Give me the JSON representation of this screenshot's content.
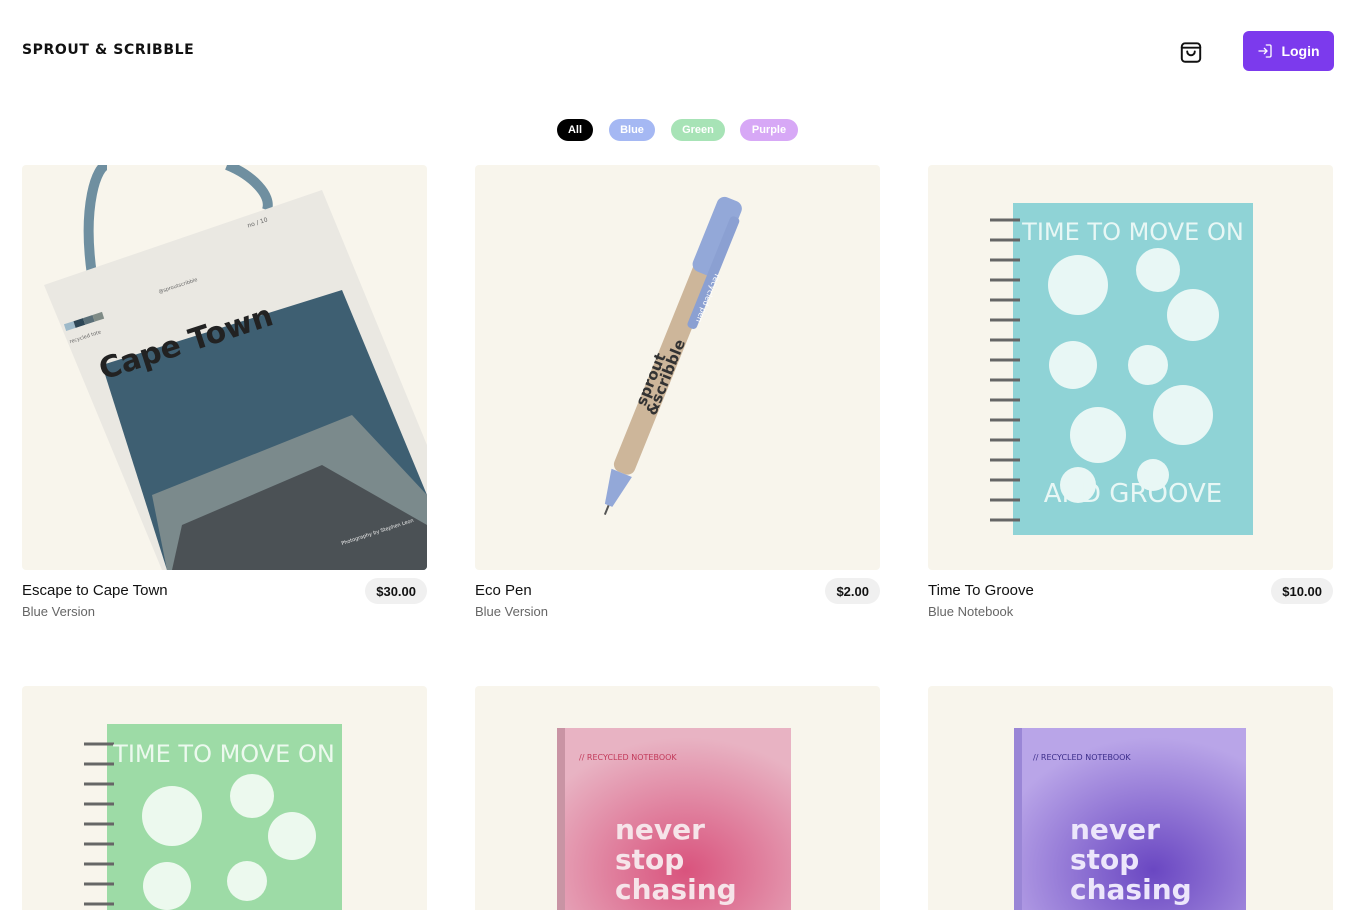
{
  "brand": "SPROUT & SCRIBBLE",
  "header": {
    "cart_icon": "shopping-bag-icon",
    "login_label": "Login",
    "login_icon": "login-arrow-icon",
    "accent": "#7c3aed"
  },
  "filters": [
    {
      "label": "All",
      "color": "#000000"
    },
    {
      "label": "Blue",
      "color": "#a5b8f3"
    },
    {
      "label": "Green",
      "color": "#a7e3b6"
    },
    {
      "label": "Purple",
      "color": "#d7a8f6"
    }
  ],
  "products": [
    {
      "name": "Escape to Cape Town",
      "variant": "Blue Version",
      "price": "$30.00",
      "art": {
        "title": "Cape Town",
        "tag": "recycled tote",
        "handle": "@sproutscribble",
        "count": "no / 10",
        "credit": "Photography by Stephen Leon"
      }
    },
    {
      "name": "Eco Pen",
      "variant": "Blue Version",
      "price": "$2.00",
      "art": {
        "line1": "sprout",
        "line2": "&scribble",
        "clip": "recycled pen"
      }
    },
    {
      "name": "Time To Groove",
      "variant": "Blue Notebook",
      "price": "$10.00",
      "art": {
        "top": "TIME TO MOVE ON",
        "bottom": "AND GROOVE"
      }
    },
    {
      "art": {
        "top": "TIME TO MOVE ON"
      }
    },
    {
      "art": {
        "tag": "// RECYCLED NOTEBOOK",
        "line1": "never",
        "line2": "stop",
        "line3": "chasing"
      }
    },
    {
      "art": {
        "tag": "// RECYCLED NOTEBOOK",
        "line1": "never",
        "line2": "stop",
        "line3": "chasing"
      }
    }
  ]
}
